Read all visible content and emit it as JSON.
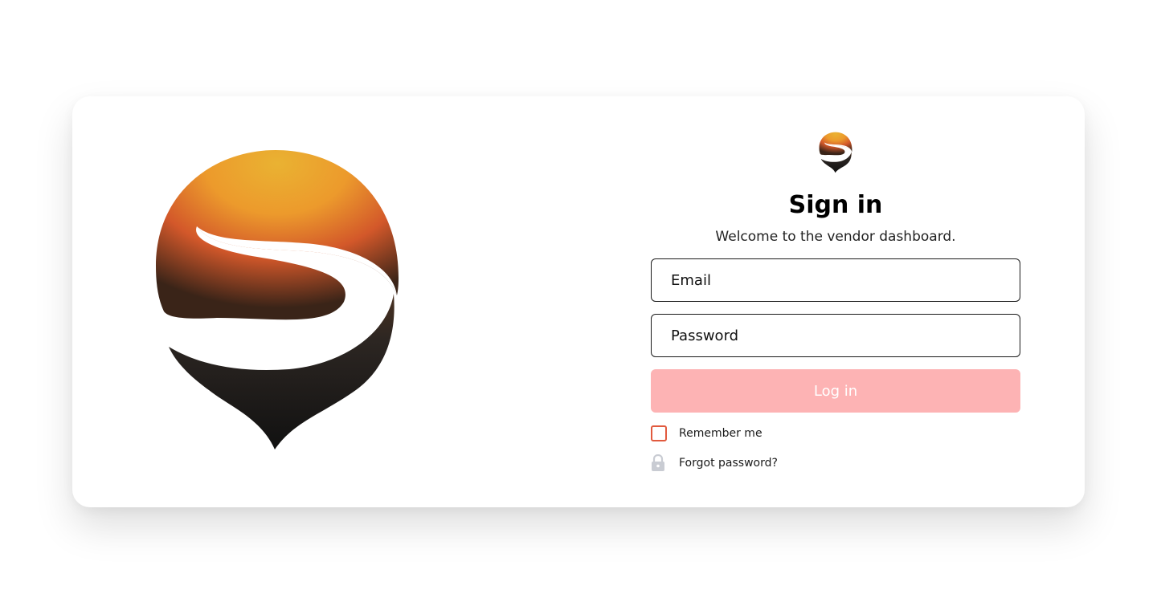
{
  "brand": {
    "logo_icon": "s-drop-logo-icon",
    "colors": {
      "logo_top": "#e8b035",
      "logo_mid": "#d45a28",
      "logo_bottom": "#222222",
      "button_bg": "#fdb3b4",
      "checkbox_border": "#e15a3e"
    }
  },
  "signin": {
    "title": "Sign in",
    "subtitle": "Welcome to the vendor dashboard.",
    "email_placeholder": "Email",
    "password_placeholder": "Password",
    "login_label": "Log in",
    "remember_label": "Remember me",
    "remember_checked": false,
    "forgot_label": "Forgot password?",
    "lock_icon": "lock-icon"
  }
}
